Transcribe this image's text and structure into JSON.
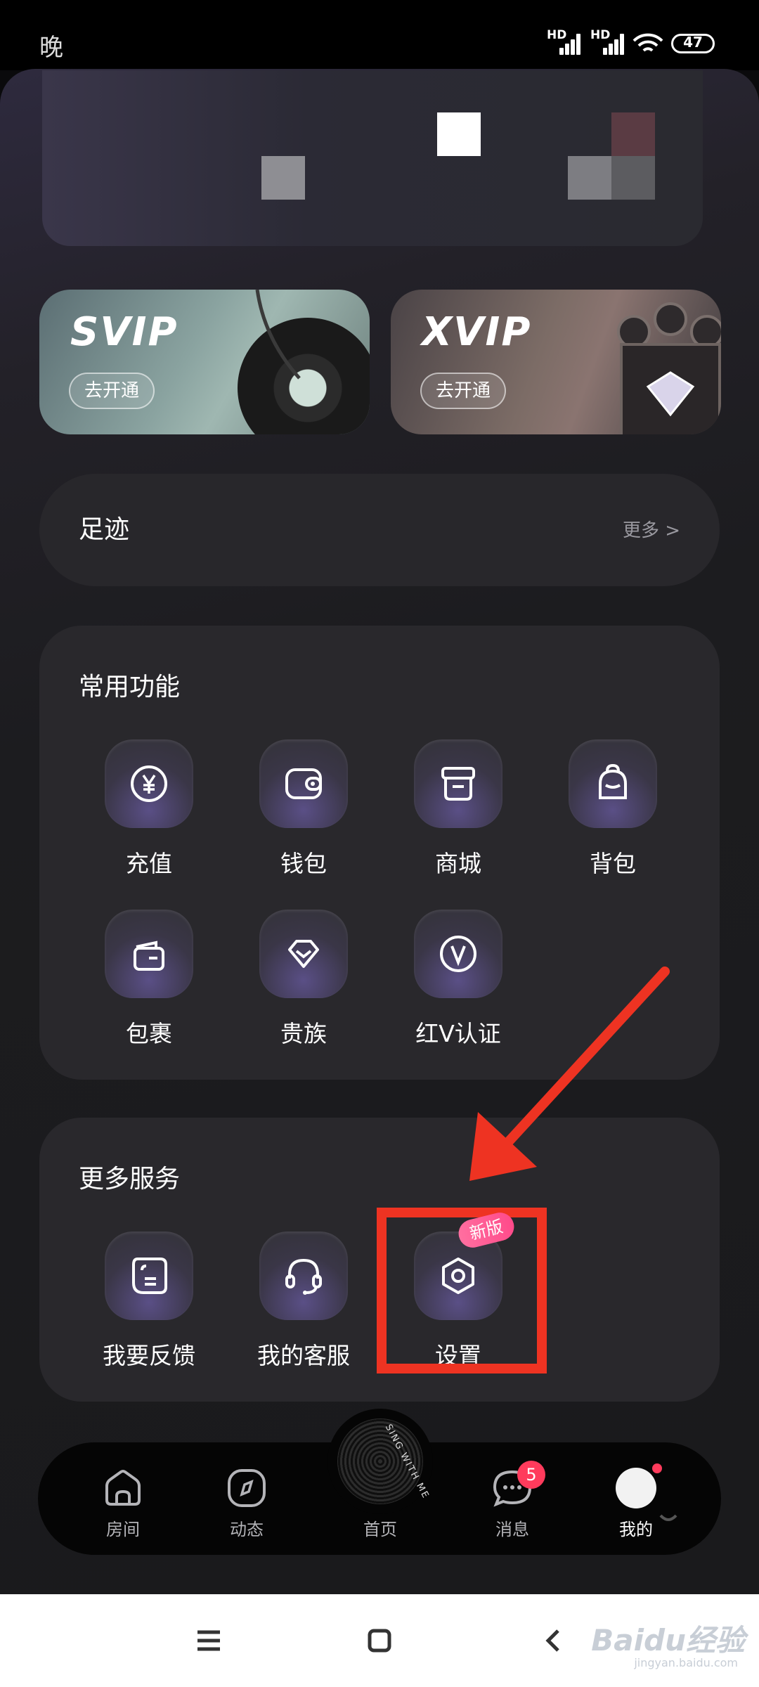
{
  "status_bar": {
    "time": "晚",
    "sim1_label": "HD",
    "sim2_label": "HD",
    "battery": "47"
  },
  "vip": {
    "svip_title": "SVIP",
    "svip_button": "去开通",
    "xvip_title": "XVIP",
    "xvip_button": "去开通"
  },
  "footprint": {
    "title": "足迹",
    "more": "更多 >"
  },
  "common_functions": {
    "title": "常用功能",
    "items": [
      {
        "label": "充值",
        "icon": "yuan-coin-icon"
      },
      {
        "label": "钱包",
        "icon": "wallet-icon"
      },
      {
        "label": "商城",
        "icon": "store-icon"
      },
      {
        "label": "背包",
        "icon": "backpack-icon"
      },
      {
        "label": "包裹",
        "icon": "package-icon"
      },
      {
        "label": "贵族",
        "icon": "noble-gem-icon"
      },
      {
        "label": "红V认证",
        "icon": "v-badge-icon"
      }
    ]
  },
  "more_services": {
    "title": "更多服务",
    "items": [
      {
        "label": "我要反馈",
        "icon": "feedback-icon"
      },
      {
        "label": "我的客服",
        "icon": "headset-icon"
      },
      {
        "label": "设置",
        "icon": "settings-hex-icon",
        "badge": "新版"
      }
    ]
  },
  "tab_bar": {
    "tabs": [
      {
        "label": "房间",
        "icon": "house-icon"
      },
      {
        "label": "动态",
        "icon": "compass-icon"
      },
      {
        "label": "首页",
        "icon": "record-disc-icon"
      },
      {
        "label": "消息",
        "icon": "chat-bubble-icon",
        "badge": "5"
      },
      {
        "label": "我的",
        "icon": "avatar-icon",
        "active": true
      }
    ],
    "disc_text": "SING WITH ME"
  },
  "watermark": {
    "brand": "Baidu经验",
    "url": "jingyan.baidu.com"
  },
  "colors": {
    "accent_red": "#ee3322",
    "badge_pink": "#ff4a8a",
    "card_bg": "#29282c"
  }
}
